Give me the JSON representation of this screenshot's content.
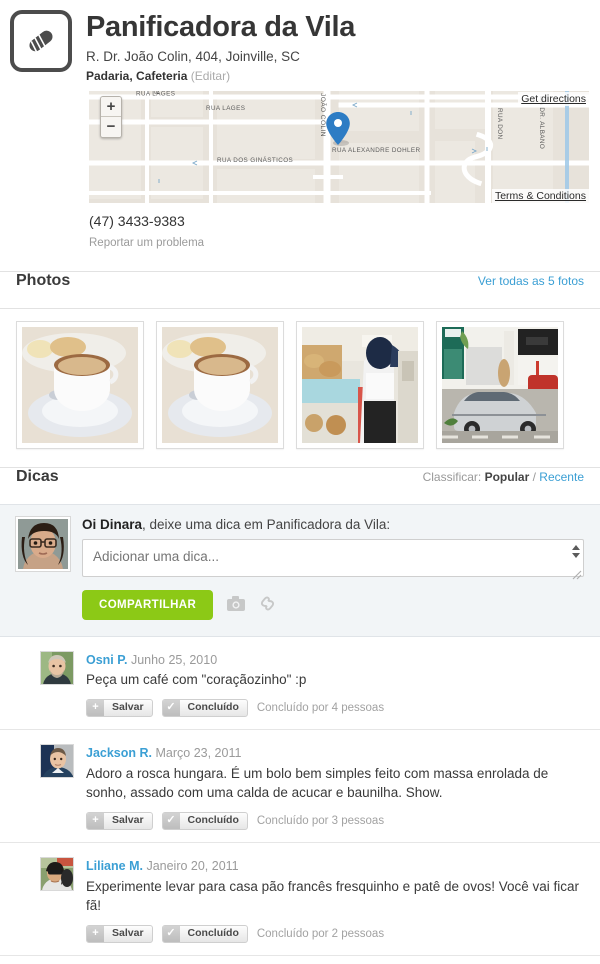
{
  "venue": {
    "icon_name": "bread-icon",
    "title": "Panificadora da Vila",
    "address": "R. Dr. João Colin, 404, Joinville, SC",
    "categories": "Padaria, Cafeteria",
    "edit_label": "(Editar)",
    "phone": "(47) 3433-9383",
    "report_label": "Reportar um problema"
  },
  "map": {
    "zoom_in": "+",
    "zoom_out": "−",
    "get_directions": "Get directions",
    "terms": "Terms & Conditions",
    "streets": [
      "RUA LAGES",
      "RUA LAGES",
      "RUA DOS GINÁSTICOS",
      "RUA ALEXANDRE DOHLER",
      "RUA DON",
      "DA DR. ALBANO",
      "JOÃO COLIN"
    ],
    "pin_color": "#2d7cc4"
  },
  "photos": {
    "title": "Photos",
    "see_all": "Ver todas as 5 fotos",
    "items": [
      {
        "alt": "Xícara de café com leite e pães"
      },
      {
        "alt": "Xícara de café com leite e pães"
      },
      {
        "alt": "Balcão da padaria com clientes"
      },
      {
        "alt": "Fachada da padaria com carro na rua"
      }
    ]
  },
  "tips": {
    "title": "Dicas",
    "sort_label": "Classificar:",
    "sort_popular": "Popular",
    "sort_sep": "/",
    "sort_recent": "Recente",
    "composer": {
      "greeting_bold": "Oi Dinara",
      "greeting_rest": ", deixe uma dica em Panificadora da Vila:",
      "placeholder": "Adicionar uma dica...",
      "value": "",
      "share_label": "COMPARTILHAR",
      "camera_icon": "camera-icon",
      "link_icon": "link-icon"
    },
    "save_label": "Salvar",
    "done_label": "Concluído",
    "items": [
      {
        "author": "Osni P.",
        "date": "Junho 25, 2010",
        "text": "Peça um café com \"coraçãozinho\" :p",
        "done_count": "Concluído por 4 pessoas"
      },
      {
        "author": "Jackson R.",
        "date": "Março 23, 2011",
        "text": "Adoro a rosca hungara. É um bolo bem simples feito com massa enrolada de sonho, assado com uma calda de acucar e baunilha. Show.",
        "done_count": "Concluído por 3 pessoas"
      },
      {
        "author": "Liliane M.",
        "date": "Janeiro 20, 2011",
        "text": "Experimente levar para casa pão francês fresquinho e patê de ovos! Você vai ficar fã!",
        "done_count": "Concluído por 2 pessoas"
      }
    ]
  },
  "colors": {
    "link": "#3b9fd4",
    "share_button": "#8cc916",
    "map_pin": "#2d7cc4",
    "composer_bg": "#f2f5f7"
  }
}
